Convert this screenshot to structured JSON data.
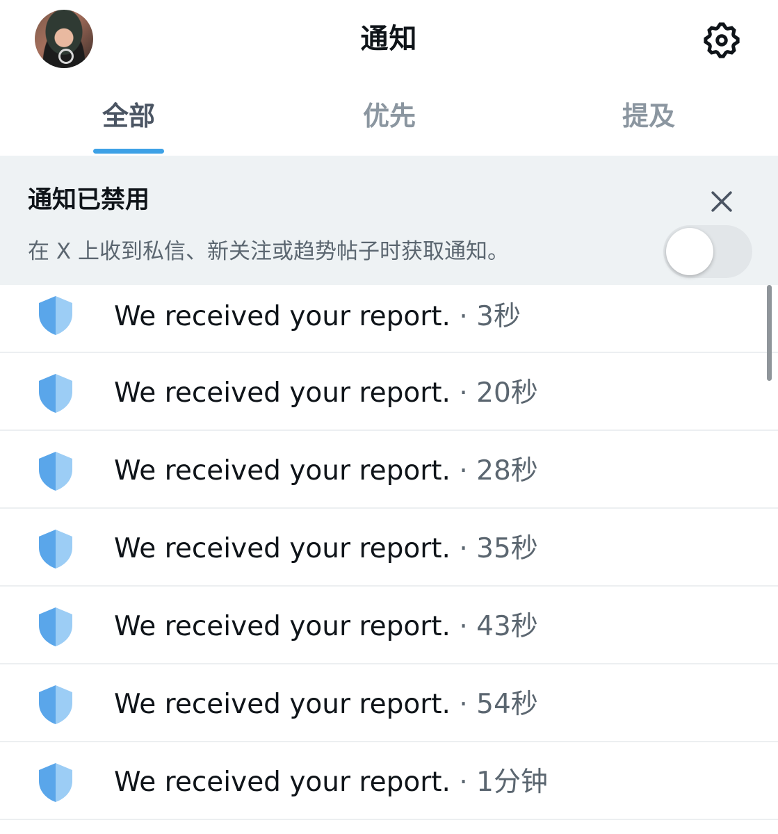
{
  "header": {
    "title": "通知"
  },
  "tabs": [
    {
      "label": "全部",
      "active": true
    },
    {
      "label": "优先",
      "active": false
    },
    {
      "label": "提及",
      "active": false
    }
  ],
  "banner": {
    "title": "通知已禁用",
    "description": "在 X 上收到私信、新关注或趋势帖子时获取通知。",
    "toggle_on": false
  },
  "notifications": [
    {
      "icon": "shield-icon",
      "text": "We received your report.",
      "separator": " · ",
      "time": "3秒"
    },
    {
      "icon": "shield-icon",
      "text": "We received your report.",
      "separator": " · ",
      "time": "20秒"
    },
    {
      "icon": "shield-icon",
      "text": "We received your report.",
      "separator": " · ",
      "time": "28秒"
    },
    {
      "icon": "shield-icon",
      "text": "We received your report.",
      "separator": " · ",
      "time": "35秒"
    },
    {
      "icon": "shield-icon",
      "text": "We received your report.",
      "separator": " · ",
      "time": "43秒"
    },
    {
      "icon": "shield-icon",
      "text": "We received your report.",
      "separator": " · ",
      "time": "54秒"
    },
    {
      "icon": "shield-icon",
      "text": "We received your report.",
      "separator": " · ",
      "time": "1分钟"
    }
  ],
  "colors": {
    "accent": "#3da1e6",
    "shield_dark": "#5aa6ea",
    "shield_light": "#9ccdf5"
  }
}
